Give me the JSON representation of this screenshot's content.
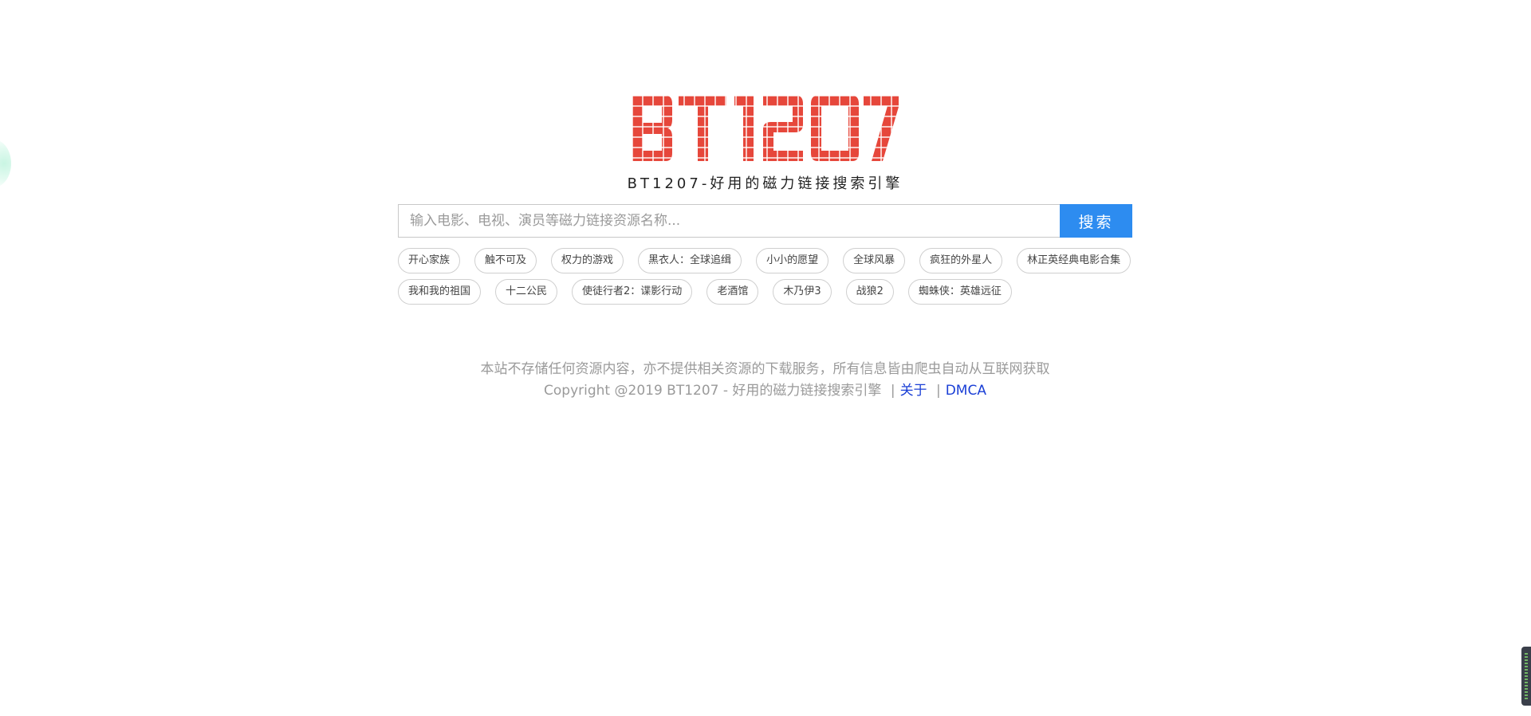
{
  "brand": {
    "logo_text": "BT1207",
    "logo_color": "#e6473b",
    "tagline": "BT1207-好用的磁力链接搜索引擎"
  },
  "search": {
    "placeholder": "输入电影、电视、演员等磁力链接资源名称...",
    "value": "",
    "button_label": "搜索",
    "button_color": "#2d8cf0"
  },
  "hot_tags": [
    "开心家族",
    "触不可及",
    "权力的游戏",
    "黑衣人：全球追缉",
    "小小的愿望",
    "全球风暴",
    "疯狂的外星人",
    "林正英经典电影合集",
    "我和我的祖国",
    "十二公民",
    "使徒行者2：谍影行动",
    "老酒馆",
    "木乃伊3",
    "战狼2",
    "蜘蛛侠：英雄远征"
  ],
  "footer": {
    "disclaimer": "本站不存储任何资源内容，亦不提供相关资源的下载服务，所有信息皆由爬虫自动从互联网获取",
    "copyright": "Copyright @2019 BT1207 - 好用的磁力链接搜索引擎",
    "separator": "|",
    "about_link": "关于",
    "dmca_link": "DMCA"
  }
}
